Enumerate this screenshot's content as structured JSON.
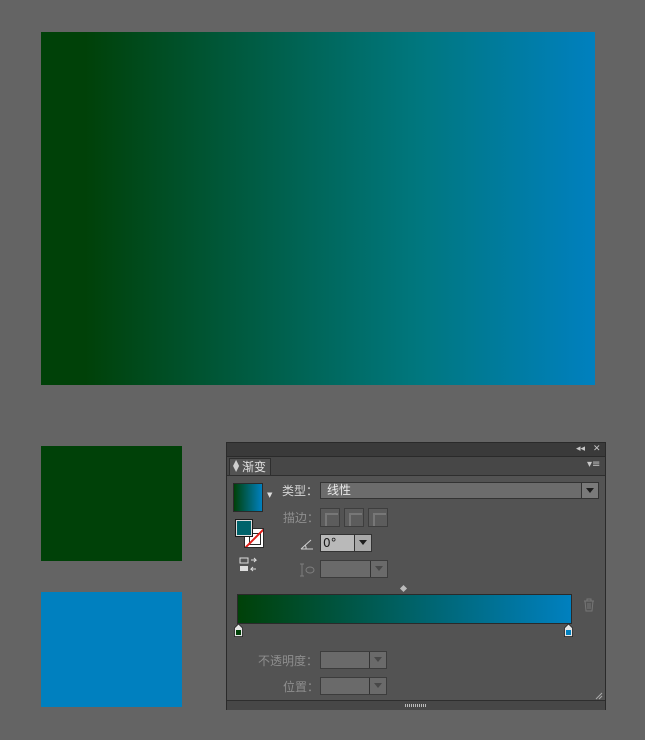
{
  "canvas": {
    "gradient_start": "#004108",
    "gradient_end": "#0080bf",
    "green_swatch": "#004108",
    "blue_swatch": "#0080bf"
  },
  "panel": {
    "tab_label": "渐变",
    "collapse_icon": "collapse-icon",
    "close_icon": "close-icon",
    "menu_icon": "panel-menu-icon",
    "type_label": "类型：",
    "type_value": "线性",
    "stroke_label": "描边：",
    "angle_value": "0°",
    "aspect_value": "",
    "opacity_label": "不透明度：",
    "opacity_value": "",
    "location_label": "位置：",
    "location_value": "",
    "stop_colors": [
      "#004108",
      "#0080bf"
    ]
  }
}
